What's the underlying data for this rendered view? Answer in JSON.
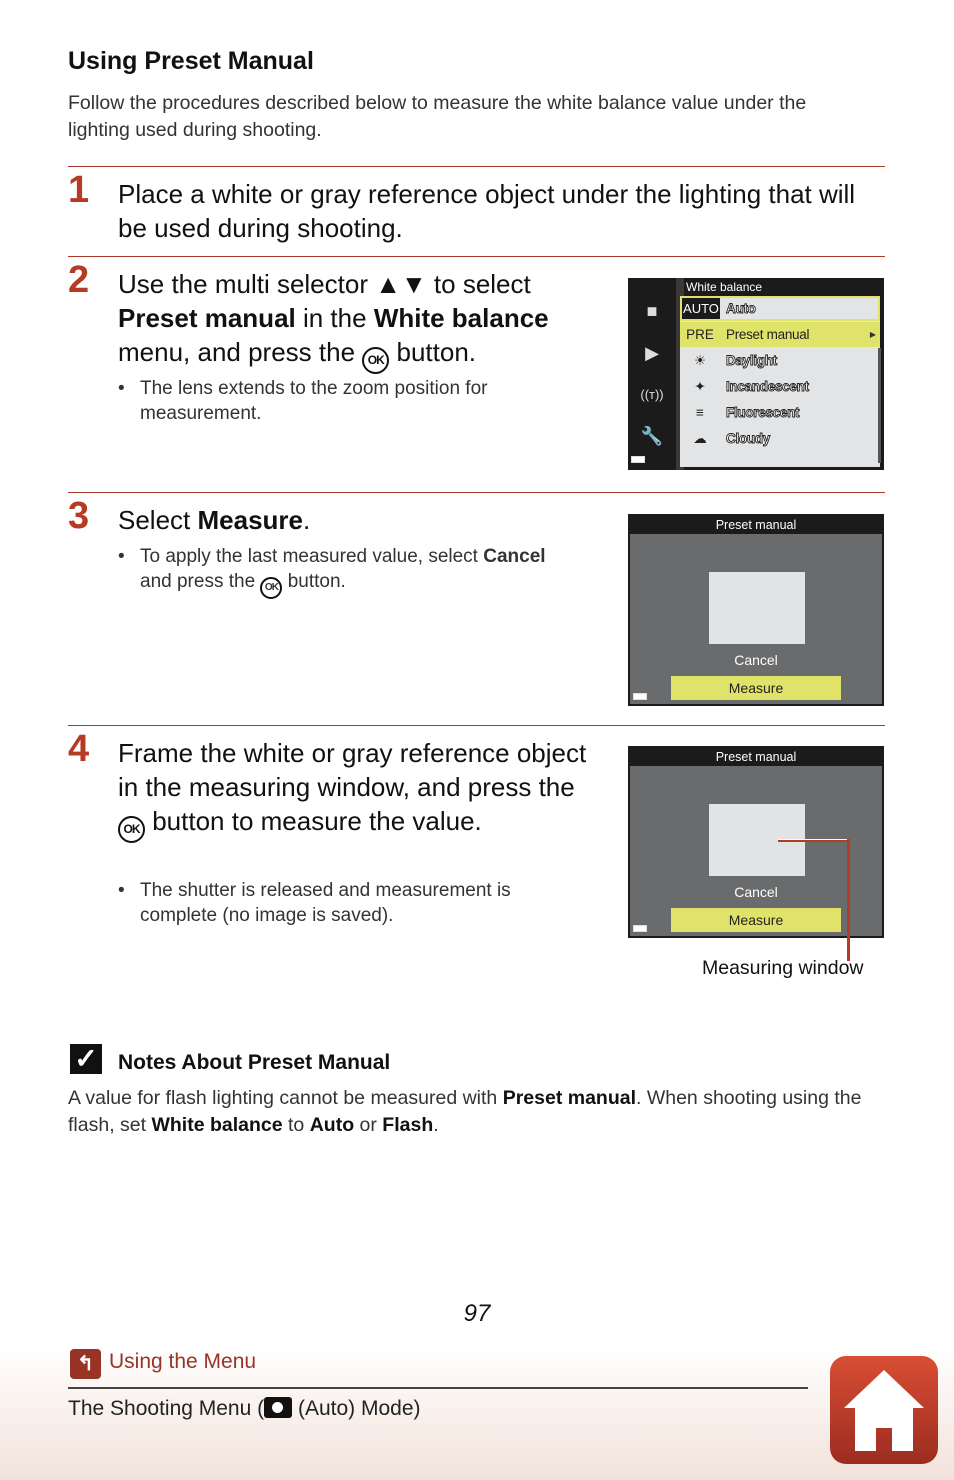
{
  "section_title": "Using Preset Manual",
  "intro": "Follow the procedures described below to measure the white balance value under the lighting used during shooting.",
  "steps": [
    {
      "number": "1",
      "text": "Place a white or gray reference object under the lighting that will be used during shooting."
    },
    {
      "number": "2",
      "text_parts": [
        "Use the multi selector ",
        "▲▼",
        " to select ",
        "Preset manual",
        " in the ",
        "White balance",
        " menu, and press the ",
        "OK",
        " button."
      ],
      "bullet": "The lens extends to the zoom position for measurement."
    },
    {
      "number": "3",
      "text_parts": [
        "Select ",
        "Measure",
        "."
      ],
      "bullet_parts": [
        "To apply the last measured value, select ",
        "Cancel",
        " and press the ",
        "OK",
        " button."
      ]
    },
    {
      "number": "4",
      "text_parts": [
        "Frame the white or gray reference object in the measuring window, and press the ",
        "OK",
        " button to measure the value."
      ],
      "bullet": "The shutter is released and measurement is complete (no image is saved)."
    }
  ],
  "wb_screen": {
    "title": "White balance",
    "items": [
      {
        "icon": "AUTO",
        "label": "Auto"
      },
      {
        "icon": "PRE",
        "label": "Preset manual"
      },
      {
        "icon": "☀",
        "label": "Daylight"
      },
      {
        "icon": "✦",
        "label": "Incandescent"
      },
      {
        "icon": "≡",
        "label": "Fluorescent"
      },
      {
        "icon": "☁",
        "label": "Cloudy"
      }
    ],
    "selected": "Preset manual"
  },
  "pm_screen": {
    "title": "Preset manual",
    "cancel": "Cancel",
    "measure": "Measure"
  },
  "callout": "Measuring window",
  "note": {
    "title": "Notes About Preset Manual",
    "parts": [
      "A value for flash lighting cannot be measured with ",
      "Preset manual",
      ". When shooting using the flash, set ",
      "White balance",
      " to ",
      "Auto",
      " or ",
      "Flash",
      "."
    ]
  },
  "page_number": "97",
  "footer": {
    "back_label": "Using the Menu",
    "sub_prefix": "The Shooting Menu (",
    "sub_suffix": " (Auto) Mode)"
  }
}
